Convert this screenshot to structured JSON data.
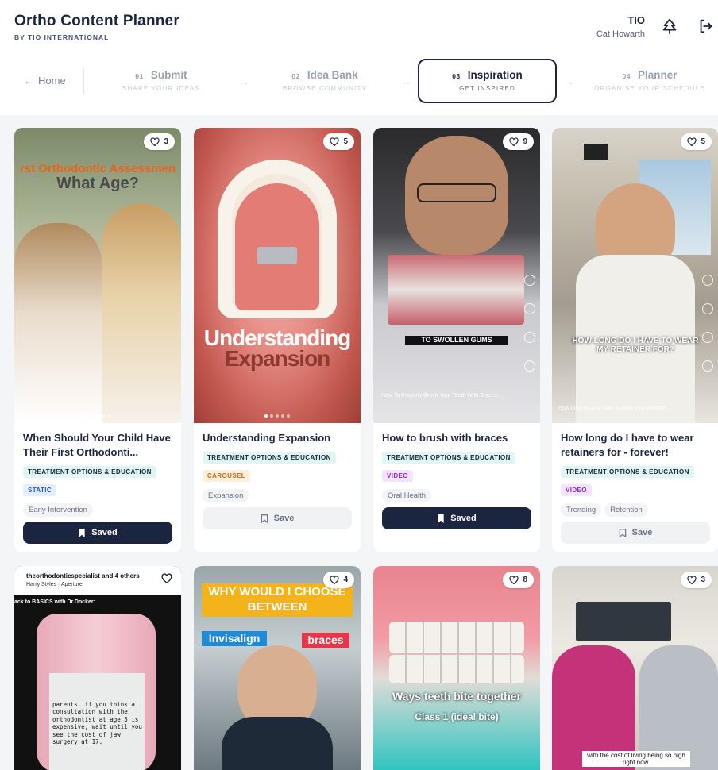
{
  "app": {
    "title": "Ortho Content Planner",
    "subtitle": "BY TIO INTERNATIONAL"
  },
  "user": {
    "org": "TIO",
    "name": "Cat Howarth"
  },
  "nav": {
    "home_label": "Home",
    "steps": [
      {
        "num": "01",
        "title": "Submit",
        "sub": "SHARE YOUR IDEAS"
      },
      {
        "num": "02",
        "title": "Idea Bank",
        "sub": "BROWSE COMMUNITY"
      },
      {
        "num": "03",
        "title": "Inspiration",
        "sub": "GET INSPIRED"
      },
      {
        "num": "04",
        "title": "Planner",
        "sub": "ORGANISE YOUR SCHEDULE"
      }
    ],
    "active_step": 2
  },
  "cards": [
    {
      "likes": "3",
      "title": "When Should Your Child Have Their First Orthodonti...",
      "category": "TREATMENT OPTIONS & EDUCATION",
      "format": "STATIC",
      "chips": [
        "Early Intervention"
      ],
      "button": "Saved",
      "overlay1": "rst Orthodontic Assessmen",
      "overlay2": "What Age?"
    },
    {
      "likes": "5",
      "title": "Understanding Expansion",
      "category": "TREATMENT OPTIONS & EDUCATION",
      "format": "CAROUSEL",
      "chips": [
        "Expansion"
      ],
      "button": "Save",
      "overlay1": "Understanding",
      "overlay2": "Expansion"
    },
    {
      "likes": "9",
      "title": "How to brush with braces",
      "category": "TREATMENT OPTIONS & EDUCATION",
      "format": "VIDEO",
      "chips": [
        "Oral Health"
      ],
      "button": "Saved",
      "overlay1": "TO SWOLLEN GUMS",
      "overlay2": "How To Properly Brush Your Teeth With Braces ..."
    },
    {
      "likes": "5",
      "title": "How long do I have to wear retainers for - forever!",
      "category": "TREATMENT OPTIONS & EDUCATION",
      "format": "VIDEO",
      "chips": [
        "Trending",
        "Retention"
      ],
      "button": "Save",
      "overlay1": "HOW LONG DO I HAVE TO WEAR MY RETAINER FOR?",
      "overlay2": "How long do you have to wear your retainer ..."
    },
    {
      "likes": "",
      "overlay1": "theorthodonticspecialist and 4 others",
      "overlay2": "Harry Styles · Aperture",
      "overlay3": "ack to BASICS with Dr.Docker:",
      "overlay4": "parents, if you think a consultation with the orthodontist at age 5 is expensive, wait until you see the cost of jaw surgery at 17."
    },
    {
      "likes": "4",
      "overlay1": "WHY WOULD I CHOOSE BETWEEN",
      "overlay2": "Invisalign",
      "overlay3": "braces"
    },
    {
      "likes": "8",
      "overlay1": "Ways teeth bite together",
      "overlay2": "Class 1 (ideal bite)"
    },
    {
      "likes": "3",
      "overlay1": "with the cost of living being so high right now."
    }
  ],
  "colors": {
    "navy": "#1c2540",
    "edu_tag_bg": "#dff6f3",
    "static_tag": "#2b55c9",
    "carousel_tag": "#c1681c",
    "video_tag": "#8a2fbf"
  }
}
